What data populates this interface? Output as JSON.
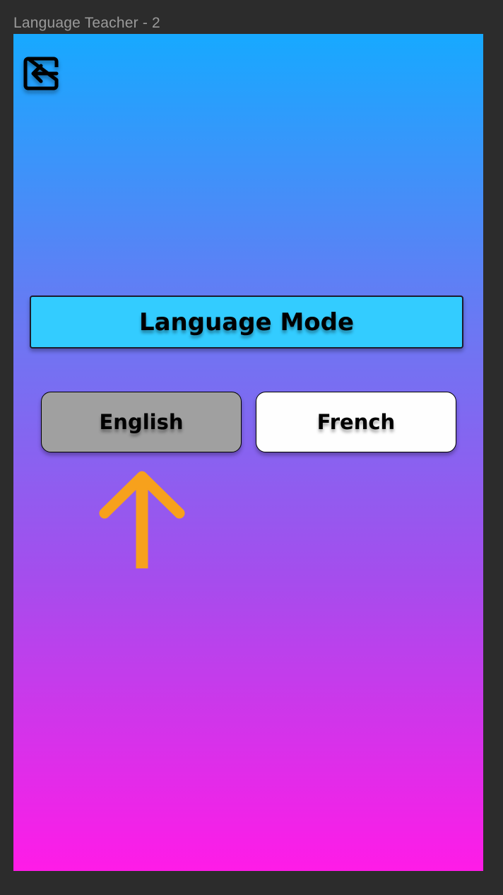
{
  "frame": {
    "title": "Language Teacher - 2"
  },
  "screen": {
    "background_gradient": [
      "#17a9ff",
      "#6b78f3",
      "#a54ded",
      "#ff1be7"
    ],
    "back_button": {
      "icon": "exit-arrow-left-icon"
    },
    "header": {
      "title": "Language Mode",
      "background": "#33ccff"
    },
    "language_options": [
      {
        "label": "English",
        "selected": true,
        "background": "#a0a0a0"
      },
      {
        "label": "French",
        "selected": false,
        "background": "#fefefe"
      }
    ],
    "pointer": {
      "icon": "arrow-up-icon",
      "color": "#f7a11c"
    }
  }
}
